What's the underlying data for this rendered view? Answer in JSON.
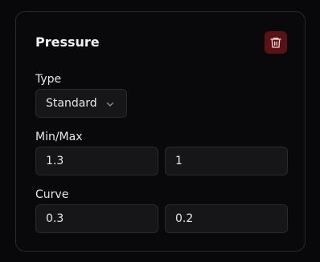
{
  "panel": {
    "title": "Pressure",
    "delete_icon": "trash-icon",
    "accent_color": "#5a1216"
  },
  "type_field": {
    "label": "Type",
    "selected": "Standard",
    "chevron_icon": "chevron-down-icon"
  },
  "min_max": {
    "label": "Min/Max",
    "min_value": "1.3",
    "max_value": "1"
  },
  "curve": {
    "label": "Curve",
    "first_value": "0.3",
    "second_value": "0.2"
  }
}
